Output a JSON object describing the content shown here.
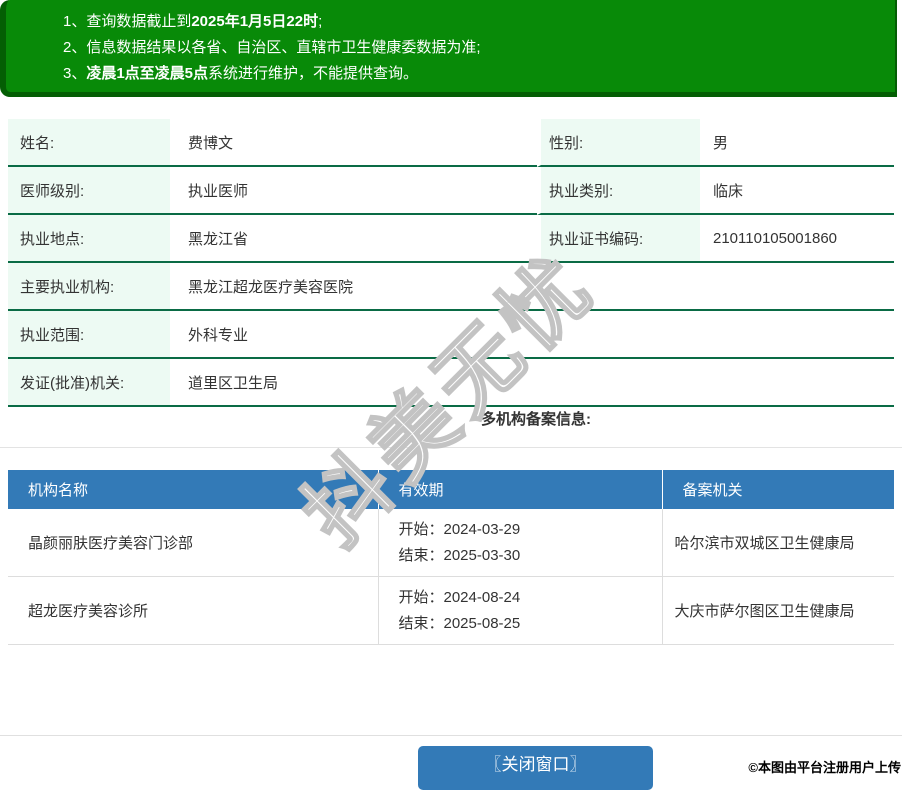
{
  "notice_banner": {
    "lines": [
      {
        "pre": "1、查询数据截止到",
        "bold": "2025年1月5日22时",
        "post": ";"
      },
      {
        "pre": "2、信息数据结果以各省、自治区、直辖市卫生健康委数据为准;",
        "bold": "",
        "post": ""
      },
      {
        "pre": "3、",
        "bold": "凌晨1点至凌晨5点",
        "post": "系统进行维护，不能提供查询。"
      }
    ]
  },
  "doctor_info": {
    "rows2col": [
      {
        "label1": "姓名:",
        "value1": "费博文",
        "label2": "性别:",
        "value2": "男"
      },
      {
        "label1": "医师级别:",
        "value1": "执业医师",
        "label2": "执业类别:",
        "value2": "临床"
      },
      {
        "label1": "执业地点:",
        "value1": "黑龙江省",
        "label2": "执业证书编码:",
        "value2": "210110105001860"
      }
    ],
    "rows1col": [
      {
        "label": "主要执业机构:",
        "value": "黑龙江超龙医疗美容医院"
      },
      {
        "label": "执业范围:",
        "value": "外科专业"
      },
      {
        "label": "发证(批准)机关:",
        "value": "道里区卫生局"
      }
    ]
  },
  "filing_section": {
    "title": "多机构备案信息:",
    "headers": [
      "机构名称",
      "有效期",
      "备案机关"
    ],
    "rows": [
      {
        "name": "晶颜丽肤医疗美容门诊部",
        "start": "开始：2024-03-29",
        "end": "结束：2025-03-30",
        "authority": "哈尔滨市双城区卫生健康局"
      },
      {
        "name": "超龙医疗美容诊所",
        "start": "开始：2024-08-24",
        "end": "结束：2025-08-25",
        "authority": "大庆市萨尔图区卫生健康局"
      }
    ]
  },
  "watermark": {
    "text": "抖美无忧"
  },
  "footer": {
    "close_button": "〖关闭窗口〗",
    "copyright": "©本图由平台注册用户上传"
  },
  "colors": {
    "banner_green": "#088A08",
    "banner_border_green": "#045E04",
    "info_border_green": "#0A6B45",
    "label_bg_mint": "#EDFAF3",
    "header_blue": "#337AB7",
    "body_border_gray": "#DDDDDD",
    "text": "#333333"
  }
}
